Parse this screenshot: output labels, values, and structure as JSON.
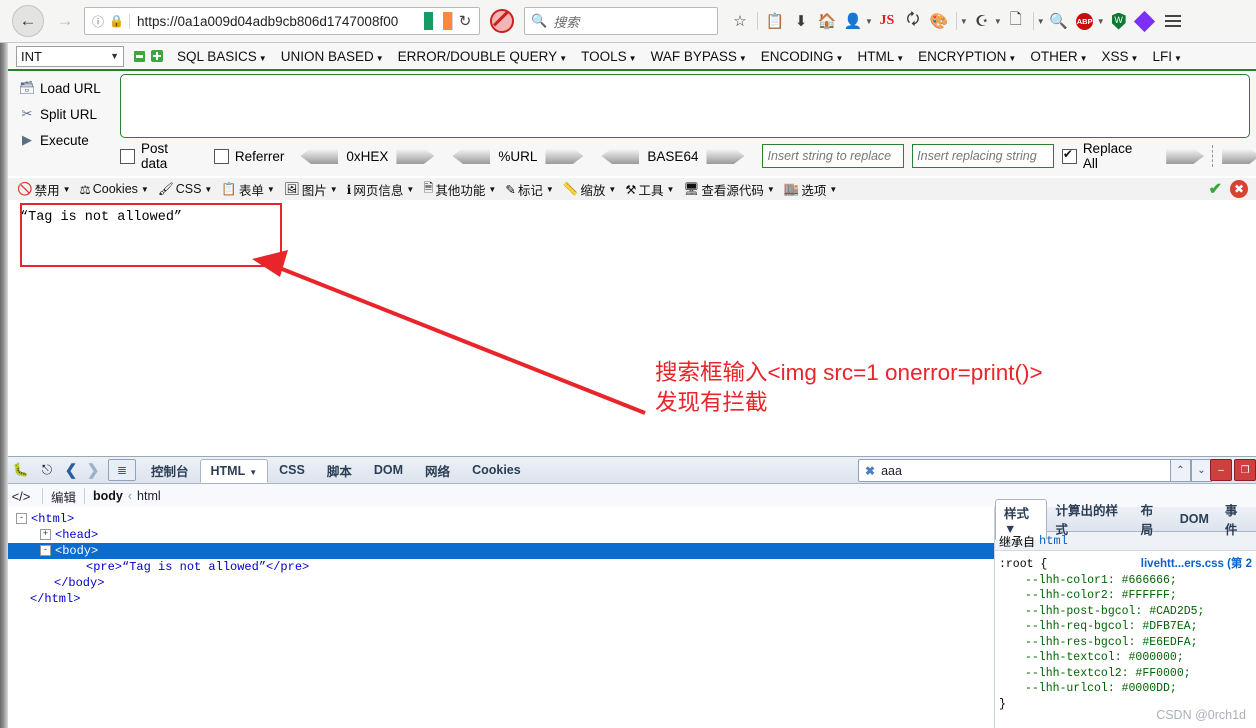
{
  "browser": {
    "url": "https://0a1a009d04adb9cb806d1747008f00",
    "search_placeholder": "搜索",
    "icons": [
      "star-icon",
      "clipboard-icon",
      "download-icon",
      "home-icon",
      "user-icon",
      "js-icon",
      "translate-icon",
      "palette-icon",
      "sync-icon",
      "copy-icon",
      "zoom-icon",
      "abp-icon",
      "shield-icon",
      "diamond-icon",
      "menu-icon"
    ],
    "back_glyph": "←",
    "forward_glyph": "→",
    "reload_glyph": "↻",
    "info_glyph": "ⓘ",
    "lock_glyph": "🔒",
    "search_glyph": "🔍",
    "abp_label": "ABP",
    "js_label": "JS"
  },
  "hackbar": {
    "select_value": "INT",
    "menu": [
      {
        "label": "SQL BASICS"
      },
      {
        "label": "UNION BASED"
      },
      {
        "label": "ERROR/DOUBLE QUERY"
      },
      {
        "label": "TOOLS"
      },
      {
        "label": "WAF BYPASS"
      },
      {
        "label": "ENCODING"
      },
      {
        "label": "HTML"
      },
      {
        "label": "ENCRYPTION"
      },
      {
        "label": "OTHER"
      },
      {
        "label": "XSS"
      },
      {
        "label": "LFI"
      }
    ],
    "actions": [
      {
        "label": "Load URL",
        "icon": "load-url-icon"
      },
      {
        "label": "Split URL",
        "icon": "scissors-icon"
      },
      {
        "label": "Execute",
        "icon": "play-icon"
      }
    ],
    "url_value": "",
    "post_data_label": "Post data",
    "referrer_label": "Referrer",
    "post_data_checked": false,
    "referrer_checked": false,
    "encoders": [
      "0xHEX",
      "%URL",
      "BASE64"
    ],
    "replace_search_placeholder": "Insert string to replace",
    "replace_with_placeholder": "Insert replacing string",
    "replace_all_label": "Replace All",
    "replace_all_checked": true
  },
  "webdev_toolbar": {
    "items": [
      {
        "label": "禁用",
        "icon": "disable-icon"
      },
      {
        "label": "Cookies",
        "icon": "cookie-icon"
      },
      {
        "label": "CSS",
        "icon": "css-icon"
      },
      {
        "label": "表单",
        "icon": "form-icon"
      },
      {
        "label": "图片",
        "icon": "image-icon"
      },
      {
        "label": "网页信息",
        "icon": "info-icon"
      },
      {
        "label": "其他功能",
        "icon": "misc-icon"
      },
      {
        "label": "标记",
        "icon": "pencil-icon"
      },
      {
        "label": "缩放",
        "icon": "ruler-icon"
      },
      {
        "label": "工具",
        "icon": "tools-icon"
      },
      {
        "label": "查看源代码",
        "icon": "source-icon"
      },
      {
        "label": "选项",
        "icon": "options-icon"
      }
    ],
    "status_ok": "✔",
    "status_error": "✖"
  },
  "page": {
    "body_text": "“Tag is not allowed”",
    "annotation_text": "搜索框输入<img src=1 onerror=print()>\n发现有拦截",
    "annotation_color": "#e8252a"
  },
  "firebug": {
    "tabs": [
      {
        "label": "控制台",
        "active": false,
        "has_caret": false
      },
      {
        "label": "HTML",
        "active": true,
        "has_caret": true
      },
      {
        "label": "CSS",
        "active": false,
        "has_caret": false
      },
      {
        "label": "脚本",
        "active": false,
        "has_caret": false
      },
      {
        "label": "DOM",
        "active": false,
        "has_caret": false
      },
      {
        "label": "网络",
        "active": false,
        "has_caret": false
      },
      {
        "label": "Cookies",
        "active": false,
        "has_caret": false
      }
    ],
    "search_value": "aaa",
    "toolbar_icons": [
      "firebug-icon",
      "inspect-icon",
      "back-icon",
      "forward-icon",
      "panel-list-icon"
    ],
    "sub_edit_label": "编辑",
    "breadcrumb_current": "body",
    "breadcrumb_sep": "‹",
    "breadcrumb_parent": "html",
    "dom_lines": [
      {
        "indent": 0,
        "toggle": "-",
        "text": "<html>",
        "selected": false
      },
      {
        "indent": 1,
        "toggle": "+",
        "text": "<head>",
        "selected": false
      },
      {
        "indent": 1,
        "toggle": "-",
        "text": "<body>",
        "selected": true
      },
      {
        "indent": 3,
        "toggle": "",
        "text": "<pre>“Tag is not allowed”</pre>",
        "selected": false
      },
      {
        "indent": 1,
        "toggle": "",
        "text": "</body>",
        "selected": false
      },
      {
        "indent": 0,
        "toggle": "",
        "text": "</html>",
        "selected": false
      }
    ],
    "css_tabs": [
      {
        "label": "样式",
        "active": true,
        "has_caret": true
      },
      {
        "label": "计算出的样式",
        "active": false,
        "has_caret": false
      },
      {
        "label": "布局",
        "active": false,
        "has_caret": false
      },
      {
        "label": "DOM",
        "active": false,
        "has_caret": false
      },
      {
        "label": "事件",
        "active": false,
        "has_caret": false
      }
    ],
    "css_inherit_label": "继承自",
    "css_inherit_target": "html",
    "css_file_label": "livehtt...ers.css (第 2",
    "css_selector": ":root {",
    "css_close": "}",
    "css_props": [
      "--lhh-color1: #666666;",
      "--lhh-color2: #FFFFFF;",
      "--lhh-post-bgcol: #CAD2D5;",
      "--lhh-req-bgcol: #DFB7EA;",
      "--lhh-res-bgcol: #E6EDFA;",
      "--lhh-textcol: #000000;",
      "--lhh-textcol2: #FF0000;",
      "--lhh-urlcol: #0000DD;"
    ],
    "win_minimize": "–",
    "win_restore": "❐",
    "spin_up": "⌃",
    "spin_down": "⌄"
  },
  "watermark": "CSDN @0rch1d"
}
